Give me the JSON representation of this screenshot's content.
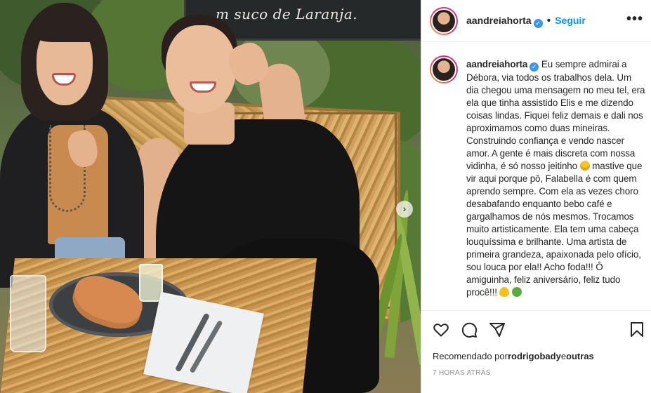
{
  "photo": {
    "chalkboard_text": "m suco de Laranja.",
    "next_arrow": "›"
  },
  "post": {
    "username": "aandreiahorta",
    "verified": true,
    "follow_label": "Seguir",
    "more_label": "•••",
    "caption_user": "aandreiahorta",
    "caption_parts": [
      "Eu sempre admirai a Débora, via todos os trabalhos dela. Um dia chegou uma mensagem no meu tel, era ela que tinha assistido Elis e me dizendo coisas lindas. Fiquei feliz demais e dali nos aproximamos como duas mineiras. Construindo confiança e vendo nascer amor. A gente é mais discreta com nossa vidinha, é só nosso jeitinho ",
      " mastive que vir aqui porque pô, Falabella é com quem aprendo sempre. Com ela as vezes choro desabafando enquanto bebo café e gargalhamos de nós mesmos. Trocamos muito artisticamente. Ela tem uma cabeça louquíssima e brilhante. Uma artista de primeira grandeza, apaixonada pelo ofício, sou louca por ela!! Acho foda!!! Ô amiguinha, feliz aniversário, feliz tudo procê!!! "
    ],
    "emojis": [
      "grinning-sweat-emoji",
      "yellow-heart-emoji",
      "four-leaf-clover-emoji"
    ],
    "liked_prefix": "Recomendado por",
    "liked_user": "rodrigobady",
    "liked_suffix": "e",
    "liked_others": "outras",
    "timestamp": "7 HORAS ATRÁS",
    "accent_color": "#0095f6",
    "verified_color": "#3897f0"
  }
}
